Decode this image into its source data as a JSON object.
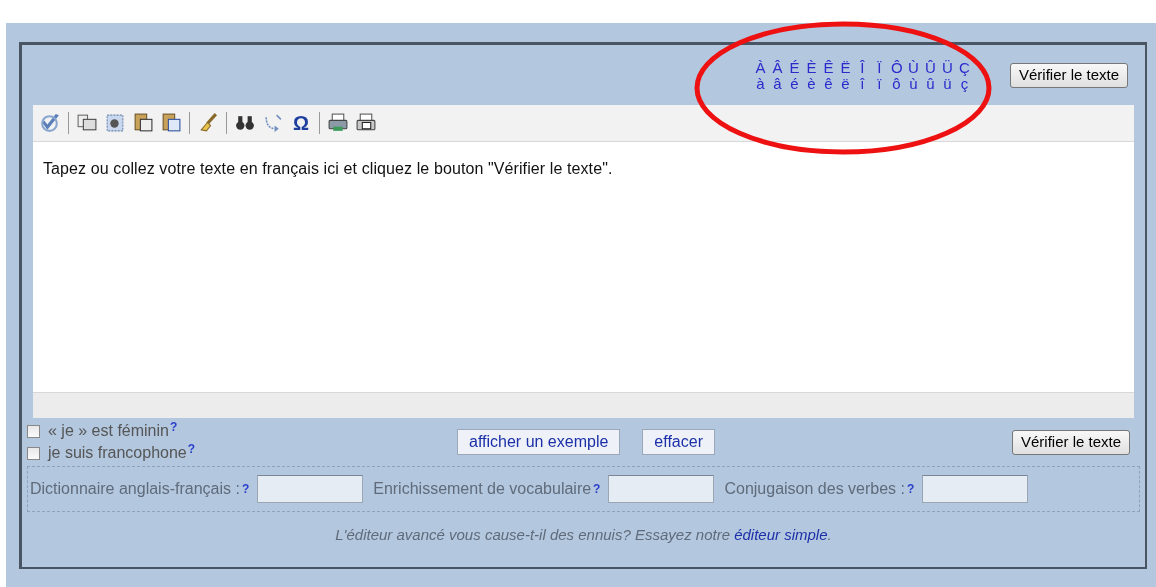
{
  "accents": {
    "upper": [
      "À",
      "Â",
      "É",
      "È",
      "Ê",
      "Ë",
      "Î",
      "Ï",
      "Ô",
      "Ù",
      "Û",
      "Ü",
      "Ç"
    ],
    "lower": [
      "à",
      "â",
      "é",
      "è",
      "ê",
      "ë",
      "î",
      "ï",
      "ô",
      "ù",
      "û",
      "ü",
      "ç"
    ]
  },
  "top_button": "Vérifier le texte",
  "toolbar": [
    {
      "kind": "check"
    },
    {
      "kind": "sep"
    },
    {
      "kind": "copy"
    },
    {
      "kind": "select"
    },
    {
      "kind": "paste"
    },
    {
      "kind": "paste-word"
    },
    {
      "kind": "sep"
    },
    {
      "kind": "brush"
    },
    {
      "kind": "sep"
    },
    {
      "kind": "find"
    },
    {
      "kind": "replace"
    },
    {
      "kind": "char",
      "text": "Ω"
    },
    {
      "kind": "sep"
    },
    {
      "kind": "print"
    },
    {
      "kind": "print-text"
    }
  ],
  "editor": {
    "text": "Tapez ou collez votre texte en français ici et cliquez le bouton \"Vérifier le texte\"."
  },
  "options": [
    {
      "label": "« je » est féminin",
      "help": "?",
      "checked": false
    },
    {
      "label": "je suis francophone",
      "help": "?",
      "checked": false
    }
  ],
  "buttons": [
    "afficher un exemple",
    "effacer"
  ],
  "bottom_button": "Vérifier le texte",
  "lookups": [
    {
      "label": "Dictionnaire anglais-français :",
      "help": "?"
    },
    {
      "label": "Enrichissement de vocabulaire",
      "help": "?"
    },
    {
      "label": "Conjugaison des verbes :",
      "help": "?"
    }
  ],
  "footer": {
    "text": "L'éditeur avancé vous cause-t-il des ennuis? Essayez notre ",
    "link": "éditeur simple",
    "after": "."
  }
}
